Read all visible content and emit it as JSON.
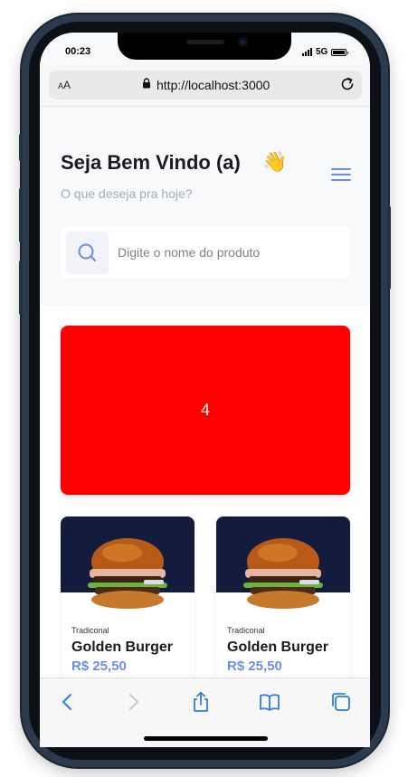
{
  "status": {
    "time": "00:23",
    "network": "5G"
  },
  "browser": {
    "aa_label": "A",
    "aa_large": "A",
    "url": "http://localhost:3000"
  },
  "header": {
    "title": "Seja Bem Vindo (a)",
    "emoji": "👋",
    "subtitle": "O que deseja pra hoje?"
  },
  "search": {
    "placeholder": "Digite o nome do produto"
  },
  "banner": {
    "text": "4",
    "color": "#ff0000"
  },
  "products": [
    {
      "category": "Tradiconal",
      "name": "Golden Burger",
      "price": "R$ 25,50"
    },
    {
      "category": "Tradiconal",
      "name": "Golden Burger",
      "price": "R$ 25,50"
    }
  ],
  "colors": {
    "accent": "#6d8ed8",
    "card_bg": "#141c3e"
  },
  "toolbar": {
    "icons": [
      "back-icon",
      "forward-icon",
      "share-icon",
      "bookmarks-icon",
      "tabs-icon"
    ]
  }
}
